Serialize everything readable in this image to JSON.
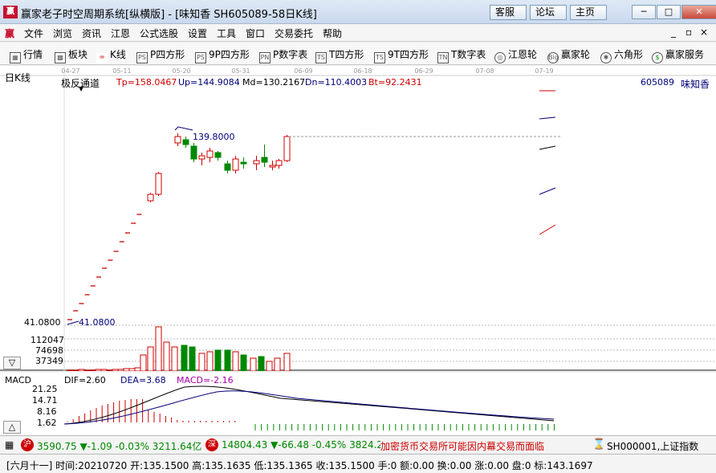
{
  "window": {
    "logo_text": "赢",
    "title": "赢家老子时空周期系统[纵横版] - [味知香  SH605089-58日K线]",
    "top_buttons": [
      "客服",
      "论坛",
      "主页"
    ],
    "win_controls": [
      "─",
      "□",
      "✕"
    ]
  },
  "menu": {
    "logo_text": "赢",
    "items": [
      "文件",
      "浏览",
      "资讯",
      "江恩",
      "公式选股",
      "设置",
      "工具",
      "窗口",
      "交易委托",
      "帮助"
    ],
    "mdi_controls": [
      "_",
      "▫",
      "×"
    ]
  },
  "toolbar": {
    "items": [
      {
        "icon": "▦",
        "label": "行情"
      },
      {
        "icon": "▩",
        "label": "板块"
      },
      {
        "icon": "♒",
        "label": "K线"
      },
      {
        "icon": "PS",
        "label": "P四方形"
      },
      {
        "icon": "PS",
        "label": "9P四方形"
      },
      {
        "icon": "PN",
        "label": "P数字表"
      },
      {
        "icon": "TS",
        "label": "T四方形"
      },
      {
        "icon": "TS",
        "label": "9T四方形"
      },
      {
        "icon": "TN",
        "label": "T数字表"
      },
      {
        "icon": "◎",
        "label": "江恩轮"
      },
      {
        "icon": "Big",
        "label": "赢家轮"
      },
      {
        "icon": "✱",
        "label": "六角形"
      },
      {
        "icon": "$",
        "label": "赢家服务"
      }
    ]
  },
  "chart": {
    "period_label": "日K线",
    "indicator_name": "极反通道",
    "tp": "Tp=158.0467",
    "up": "Up=144.9084",
    "md": "Md=130.2167",
    "dn": "Dn=110.4003",
    "bt": "Bt=92.2431",
    "stock_code": "605089",
    "stock_name": "味知香",
    "dates": [
      "04-27",
      "05-11",
      "05-20",
      "05-31",
      "06-09",
      "06-18",
      "06-29",
      "07-08",
      "07-19"
    ],
    "high_label": "139.8000",
    "low_label": "41.0800",
    "low_axis_label": "41.0800",
    "volume_axis": [
      "112047",
      "74698",
      "37349"
    ],
    "scroll_arrow": "▽",
    "colors": {
      "up": "#cc0000",
      "down": "#008800",
      "volume_up": "#cc0000",
      "volume_down": "#008800"
    }
  },
  "macd": {
    "title": "MACD",
    "dif": "DIF=2.60",
    "dea": "DEA=3.68",
    "macd": "MACD=-2.16",
    "axis": [
      "21.25",
      "14.71",
      "8.16",
      "1.62"
    ],
    "scroll_arrow": "△"
  },
  "status1": {
    "sh_badge": "沪",
    "sh_text": "3590.75 ▼-1.09 -0.03% 3211.64亿",
    "sz_badge": "深",
    "sz_text": "14804.43 ▼-66.48 -0.45% 3824.27",
    "ticker": "加密货币交易所可能因内幕交易而面临",
    "index_text": "SH000001,上证指数"
  },
  "status2": {
    "text": "[六月十一] 时间:20210720 开:135.1500 高:135.1635 低:135.1365 收:135.1500 手:0 额:0.00 换:0.00 涨:0.00 盘:0 标:143.1697"
  }
}
